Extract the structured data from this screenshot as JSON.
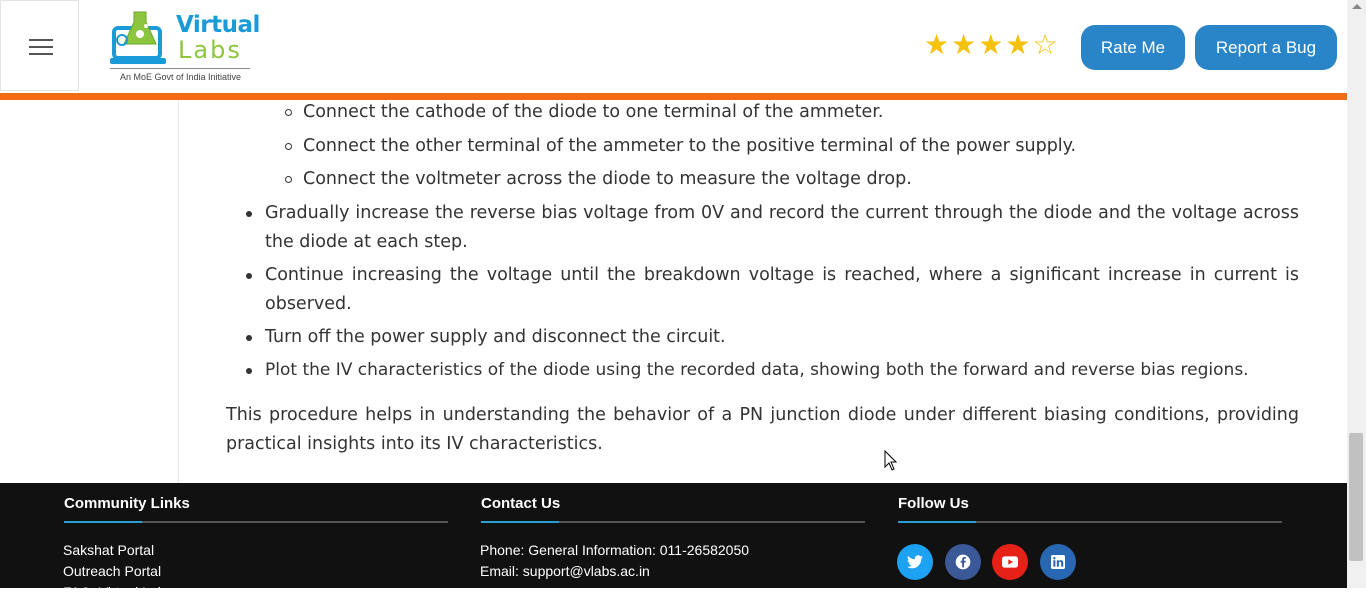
{
  "header": {
    "menu_icon": "hamburger-icon",
    "logo": {
      "word1": "Virtual",
      "word2": "Labs",
      "tagline": "An MoE Govt of India Initiative"
    },
    "rating": {
      "value": 4,
      "max": 5
    },
    "rate_button": "Rate Me",
    "bug_button": "Report a Bug"
  },
  "content": {
    "sub_items": [
      "Connect the cathode of the diode to one terminal of the ammeter.",
      "Connect the other terminal of the ammeter to the positive terminal of the power supply.",
      "Connect the voltmeter across the diode to measure the voltage drop."
    ],
    "bullets": [
      {
        "l1": "Gradually increase the reverse bias voltage from 0V and record the current through the diode and the voltage across",
        "l2": "the diode at each step."
      },
      {
        "l1": "Continue increasing the voltage until the breakdown voltage is reached, where a significant increase in current is",
        "l2": "observed."
      },
      {
        "l1": "Turn off the power supply and disconnect the circuit."
      },
      {
        "l1": "Plot the IV characteristics of the diode using the recorded data, showing both the forward and reverse bias regions."
      }
    ],
    "summary": {
      "l1": "This procedure helps in understanding the behavior of a PN junction diode under different biasing conditions, providing",
      "l2": "practical insights into its IV characteristics."
    }
  },
  "footer": {
    "community": {
      "title": "Community Links",
      "links": [
        "Sakshat Portal",
        "Outreach Portal",
        "FAQ: Virtual Labs"
      ]
    },
    "contact": {
      "title": "Contact Us",
      "phone": "Phone: General Information: 011-26582050",
      "email": "Email: support@vlabs.ac.in"
    },
    "follow": {
      "title": "Follow Us",
      "icons": [
        "twitter-icon",
        "facebook-icon",
        "youtube-icon",
        "linkedin-icon"
      ],
      "colors": {
        "twitter": "#1da1f2",
        "facebook": "#3b5998",
        "youtube": "#e62117",
        "linkedin": "#2867b2"
      }
    }
  },
  "colors": {
    "accent_bar": "#f26b15",
    "button": "#2a85c8",
    "star": "#f4c20d",
    "footer_bg": "#111111"
  }
}
